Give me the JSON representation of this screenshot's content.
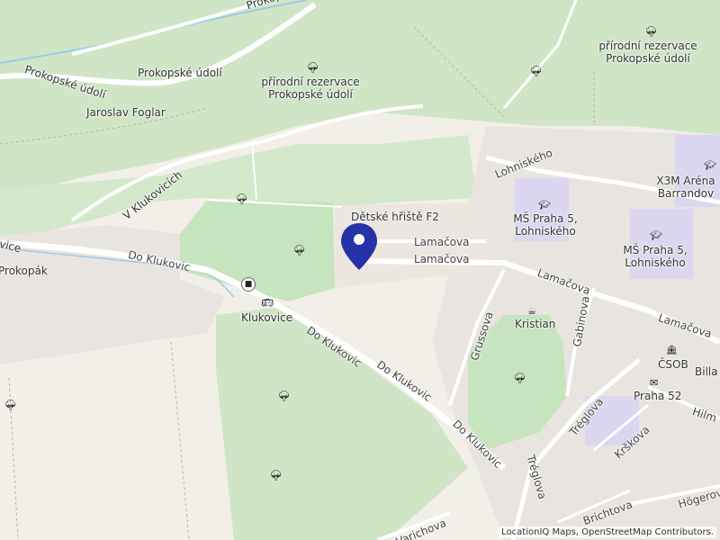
{
  "map": {
    "attribution": "LocationIQ Maps, OpenStreetMap Contributors.",
    "marker_icon": "map-pin-icon",
    "colors": {
      "background": "#f2efe9",
      "forest": "#cfe5c5",
      "park": "#c6e4bd",
      "residential": "#e8e4df",
      "school": "#dcd6f0",
      "road": "#ffffff",
      "water": "#9ccbe8",
      "marker": "#2532a8"
    }
  },
  "labels": {
    "prokopske_udoli_top": "Prokopské",
    "prokopske_udoli_road": "Prokopské údolí",
    "prokopske_udoli_place": "Prokopské údolí",
    "reserve1_line1": "přírodní rezervace",
    "reserve1_line2": "Prokopské údolí",
    "reserve2_line1": "přírodní rezervace",
    "reserve2_line2": "Prokopské údolí",
    "jaroslav_foglar": "Jaroslav Foglar",
    "v_klukovicich": "V Klukovicích",
    "detske_hriste": "Dětské hřiště F2",
    "lamacova1": "Lamačova",
    "lamacova2": "Lamačova",
    "lamacova3": "Lamačova",
    "lamacova4": "Lamačova",
    "lohniskeho": "Lohniského",
    "x3m_line1": "X3M Aréna",
    "x3m_line2": "Barrandov",
    "ms1_line1": "MŠ Praha 5,",
    "ms1_line2": "Lohniského",
    "ms2_line1": "MŠ Praha 5,",
    "ms2_line2": "Lohniského",
    "do_klukovic1": "Do Klukovic",
    "do_klukovic2": "Do Klukovic",
    "do_klukovic3": "Do Klukovic",
    "do_klukovic4": "Do Klukovic",
    "klukovice": "Klukovice",
    "prokopak": "Prokopák",
    "ovice": "ovice",
    "grussova": "Grussova",
    "kristian": "Kristian",
    "gabinova": "Gabinova",
    "csob": "ČSOB",
    "billa": "Billa",
    "praha52": "Praha 52",
    "hilm": "Hilm",
    "treglova1": "Tréglova",
    "treglova2": "Tréglova",
    "krskova": "Krškova",
    "brichtova": "Brichtova",
    "hogerova": "Högerova",
    "varichova": "Varichova"
  },
  "icons": {
    "tree": "tree-icon",
    "school": "school-icon",
    "cafe": "cafe-icon",
    "bank": "bank-icon",
    "post": "post-office-icon",
    "bus": "bus-stop-icon",
    "bus_station": "bus-station-icon"
  }
}
